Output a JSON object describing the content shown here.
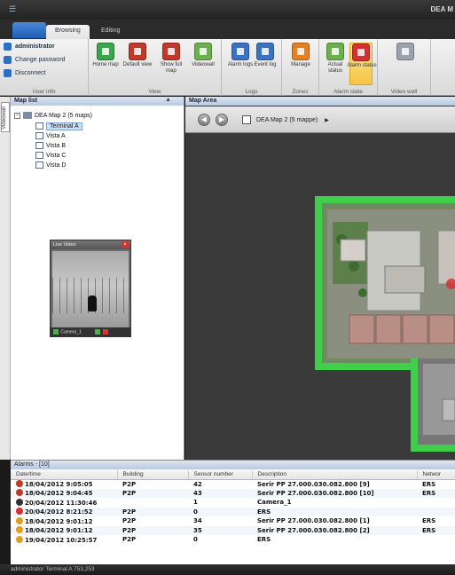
{
  "titlebar": {
    "title": "DEA M"
  },
  "ribbon_tabs": [
    {
      "label": "Browsing",
      "active": true
    },
    {
      "label": "Editing",
      "active": false
    }
  ],
  "ribbon": {
    "user_info": {
      "label": "User info",
      "username": "administrator",
      "change_password": "Change password",
      "disconnect": "Disconnect"
    },
    "view": {
      "label": "View",
      "buttons": [
        {
          "label": "Home map",
          "color": "#3aa54a"
        },
        {
          "label": "Default view",
          "color": "#c0392b"
        },
        {
          "label": "Show full map",
          "color": "#c0392b"
        },
        {
          "label": "Videowall",
          "color": "#6ab04c"
        }
      ]
    },
    "logs": {
      "label": "Logs",
      "buttons": [
        {
          "label": "Alarm logs",
          "color": "#3b73c4"
        },
        {
          "label": "Event log",
          "color": "#3b73c4"
        }
      ]
    },
    "zones": {
      "label": "Zones",
      "buttons": [
        {
          "label": "Manage",
          "color": "#e67e22"
        }
      ]
    },
    "alarm_state": {
      "label": "Alarm state",
      "buttons": [
        {
          "label": "Actual status",
          "color": "#6ab04c",
          "active": false
        },
        {
          "label": "Alarm status",
          "color": "#d63031",
          "active": true
        }
      ]
    },
    "video_wall": {
      "label": "Video wall",
      "buttons": [
        {
          "label": "",
          "color": "#9aa3ad"
        }
      ]
    }
  },
  "vstrip": {
    "tab_label": "Videowall"
  },
  "maplist": {
    "header": "Map list",
    "root": "DEA Map 2 (5 maps)",
    "items": [
      {
        "label": "Terminal A",
        "selected": true
      },
      {
        "label": "Vista A",
        "selected": false
      },
      {
        "label": "Vista B",
        "selected": false
      },
      {
        "label": "Vista C",
        "selected": false
      },
      {
        "label": "Vista D",
        "selected": false
      }
    ]
  },
  "livevideo": {
    "title": "Live Video",
    "camera_label": "Camera_1"
  },
  "maparea": {
    "header": "Map Area",
    "breadcrumb": "DEA Map 2 (5 mappe)"
  },
  "alarms": {
    "header": "Alarms - [10]",
    "columns": [
      "Date/time",
      "Building",
      "Sensor number",
      "Description",
      "Networ"
    ],
    "rows": [
      {
        "icon_color": "#c0392b",
        "datetime": "18/04/2012 9:05:05",
        "building": "P2P",
        "sensor": "42",
        "description": "Serir PP  27.000.030.082.800 [9]",
        "network": "ERS"
      },
      {
        "icon_color": "#c0392b",
        "datetime": "18/04/2012 9:04:45",
        "building": "P2P",
        "sensor": "43",
        "description": "Serir PP  27.000.030.082.800 [10]",
        "network": "ERS"
      },
      {
        "icon_color": "#333333",
        "datetime": "20/04/2012 11:30:46",
        "building": "",
        "sensor": "1",
        "description": "Camera_1",
        "network": ""
      },
      {
        "icon_color": "#d63031",
        "datetime": "20/04/2012 8:21:52",
        "building": "P2P",
        "sensor": "0",
        "description": "ERS",
        "network": ""
      },
      {
        "icon_color": "#e0a020",
        "datetime": "18/04/2012 9:01:12",
        "building": "P2P",
        "sensor": "34",
        "description": "Serir PP  27.000.030.082.800 [1]",
        "network": "ERS"
      },
      {
        "icon_color": "#e0a020",
        "datetime": "18/04/2012 9:01:12",
        "building": "P2P",
        "sensor": "35",
        "description": "Serir PP  27.000.030.082.800 [2]",
        "network": "ERS"
      },
      {
        "icon_color": "#e0a020",
        "datetime": "19/04/2012 10:25:57",
        "building": "P2P",
        "sensor": "0",
        "description": "ERS",
        "network": ""
      }
    ]
  },
  "statusbar": {
    "text": "administrator  Terminal A  753,253"
  }
}
